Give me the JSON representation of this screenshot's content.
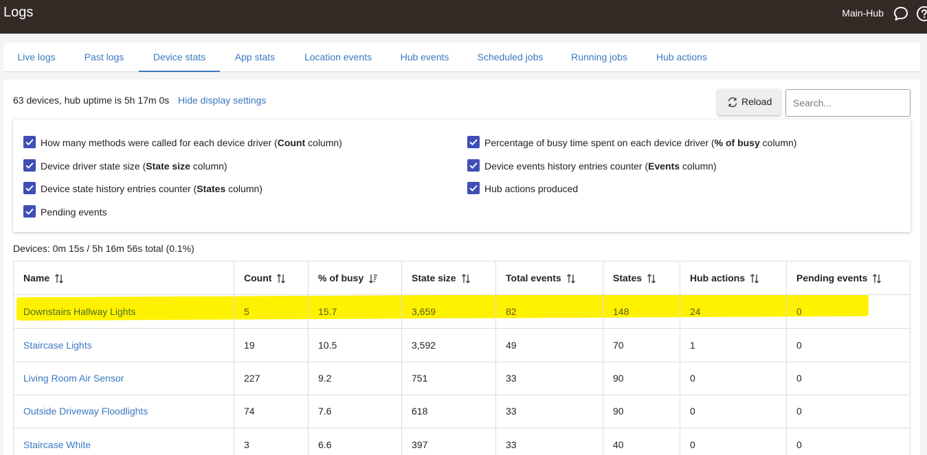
{
  "header": {
    "title": "Logs",
    "hub_name": "Main-Hub"
  },
  "tabs": [
    {
      "label": "Live logs"
    },
    {
      "label": "Past logs"
    },
    {
      "label": "Device stats",
      "active": true
    },
    {
      "label": "App stats"
    },
    {
      "label": "Location events"
    },
    {
      "label": "Hub events"
    },
    {
      "label": "Scheduled jobs"
    },
    {
      "label": "Running jobs"
    },
    {
      "label": "Hub actions"
    }
  ],
  "summary": {
    "text": "63 devices, hub uptime is 5h 17m 0s",
    "hide_settings_label": "Hide display settings"
  },
  "toolbar": {
    "reload_label": "Reload"
  },
  "search": {
    "placeholder": "Search...",
    "value": ""
  },
  "settings": [
    {
      "pre": "How many methods were called for each device driver (",
      "bold": "Count",
      "post": " column)",
      "checked": true
    },
    {
      "pre": "Device driver state size (",
      "bold": "State size",
      "post": " column)",
      "checked": true
    },
    {
      "pre": "Device state history entries counter (",
      "bold": "States",
      "post": " column)",
      "checked": true
    },
    {
      "pre": "Pending events",
      "bold": "",
      "post": "",
      "checked": true
    },
    {
      "pre": "Percentage of busy time spent on each device driver (",
      "bold": "% of busy",
      "post": " column)",
      "checked": true
    },
    {
      "pre": "Device events history entries counter (",
      "bold": "Events",
      "post": " column)",
      "checked": true
    },
    {
      "pre": "Hub actions produced",
      "bold": "",
      "post": "",
      "checked": true
    }
  ],
  "devices_summary": "Devices: 0m 15s / 5h 16m 56s total (0.1%)",
  "table": {
    "columns": [
      "Name",
      "Count",
      "% of busy",
      "State size",
      "Total events",
      "States",
      "Hub actions",
      "Pending events"
    ],
    "sorted_column": "% of busy",
    "sort_direction": "descending",
    "rows": [
      [
        "Downstairs Hallway Lights",
        "5",
        "15.7",
        "3,659",
        "82",
        "148",
        "24",
        "0"
      ],
      [
        "Staircase Lights",
        "19",
        "10.5",
        "3,592",
        "49",
        "70",
        "1",
        "0"
      ],
      [
        "Living Room Air Sensor",
        "227",
        "9.2",
        "751",
        "33",
        "90",
        "0",
        "0"
      ],
      [
        "Outside Driveway Floodlights",
        "74",
        "7.6",
        "618",
        "33",
        "90",
        "0",
        "0"
      ],
      [
        "Staircase White",
        "3",
        "6.6",
        "397",
        "33",
        "40",
        "0",
        "0"
      ]
    ],
    "highlighted_row": 0,
    "highlight_color": "#fff200"
  },
  "colors": {
    "topbar": "#342a26",
    "link": "#3a78c0",
    "checkbox": "#3f4fb5"
  }
}
